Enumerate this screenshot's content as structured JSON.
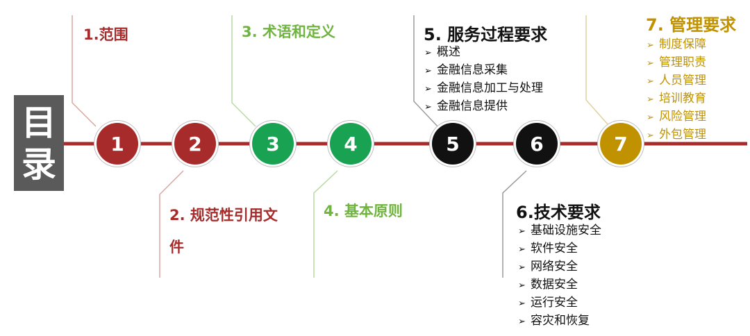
{
  "side_title": [
    "目",
    "录"
  ],
  "colors": {
    "red": "#a62b2a",
    "green": "#18a251",
    "light_green": "#6fb43f",
    "black": "#111111",
    "gold": "#c19200",
    "axis": "#a62b2a",
    "side_tag": "#5a5a5a"
  },
  "nodes": [
    {
      "label": "1",
      "color": "#a62b2a"
    },
    {
      "label": "2",
      "color": "#a62b2a"
    },
    {
      "label": "3",
      "color": "#18a251"
    },
    {
      "label": "4",
      "color": "#18a251"
    },
    {
      "label": "5",
      "color": "#111111"
    },
    {
      "label": "6",
      "color": "#111111"
    },
    {
      "label": "7",
      "color": "#c19200"
    }
  ],
  "sections": {
    "s1": {
      "title": "1.范围"
    },
    "s2": {
      "title_line1": "2. 规范性引用文",
      "title_line2": "件"
    },
    "s3": {
      "title": "3. 术语和定义"
    },
    "s4": {
      "title": "4. 基本原则"
    },
    "s5": {
      "title": "5. 服务过程要求",
      "items": [
        "概述",
        "金融信息采集",
        "金融信息加工与处理",
        "金融信息提供"
      ]
    },
    "s6": {
      "title": "6.技术要求",
      "items": [
        "基础设施安全",
        "软件安全",
        "网络安全",
        "数据安全",
        "运行安全",
        "容灾和恢复"
      ]
    },
    "s7": {
      "title": "7. 管理要求",
      "items": [
        "制度保障",
        "管理职责",
        "人员管理",
        "培训教育",
        "风险管理",
        "外包管理"
      ]
    }
  },
  "bullet_glyph": "➢"
}
